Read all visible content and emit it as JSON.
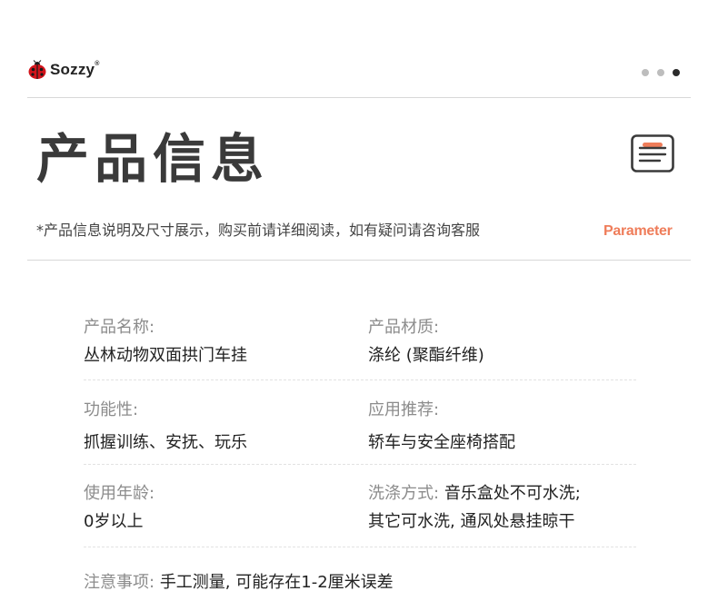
{
  "brand": {
    "name": "Sozzy",
    "reg": "®"
  },
  "pagination": {
    "total": 3,
    "active": 3
  },
  "title": "产品信息",
  "subtitle": "*产品信息说明及尺寸展示，购买前请详细阅读，如有疑问请咨询客服",
  "tag": "Parameter",
  "icons": {
    "logo": "ladybug-icon",
    "doc": "document-icon"
  },
  "colors": {
    "accent": "#ef7d5a",
    "title": "#3a3a3a",
    "label": "#8c8c8c"
  },
  "specs": {
    "name": {
      "label": "产品名称:",
      "value": "丛林动物双面拱门车挂"
    },
    "material": {
      "label": "产品材质:",
      "value": "涤纶 (聚酯纤维)"
    },
    "function": {
      "label": "功能性:",
      "value": "抓握训练、安抚、玩乐"
    },
    "usage": {
      "label": "应用推荐:",
      "value": "轿车与安全座椅搭配"
    },
    "age": {
      "label": "使用年龄:",
      "value": "0岁以上"
    },
    "wash": {
      "label": "洗涤方式:",
      "value_line1": "音乐盒处不可水洗;",
      "value_line2": "其它可水洗, 通风处悬挂晾干"
    },
    "note": {
      "label": "注意事项:",
      "value": "手工测量, 可能存在1-2厘米误差"
    }
  }
}
